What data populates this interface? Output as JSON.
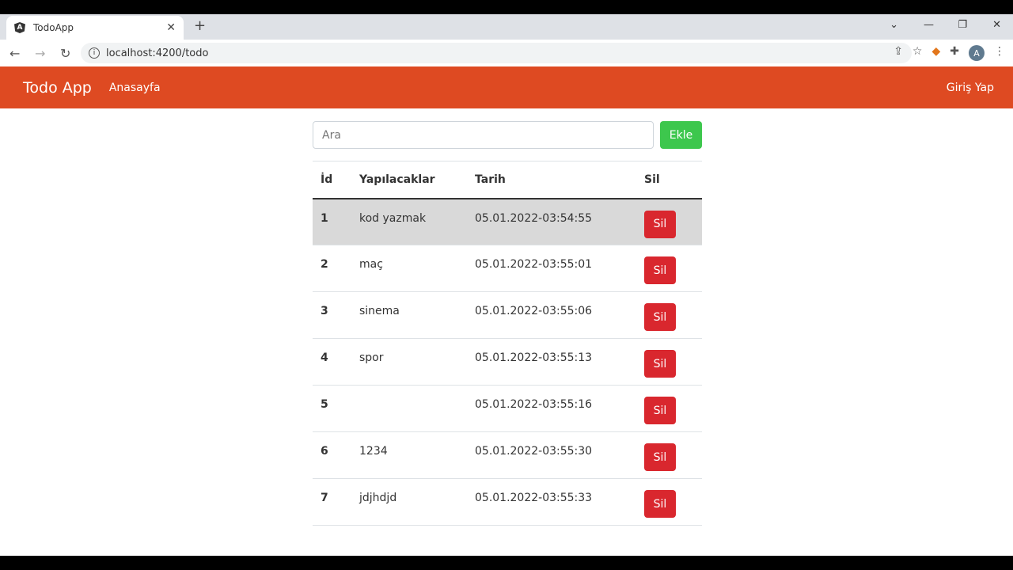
{
  "browser": {
    "tab_title": "TodoApp",
    "url": "localhost:4200/todo",
    "avatar_letter": "A"
  },
  "navbar": {
    "brand": "Todo App",
    "home": "Anasayfa",
    "login": "Giriş Yap"
  },
  "search": {
    "placeholder": "Ara",
    "add_label": "Ekle"
  },
  "table": {
    "headers": [
      "İd",
      "Yapılacaklar",
      "Tarih",
      "Sil"
    ],
    "delete_label": "Sil",
    "rows": [
      {
        "id": "1",
        "task": "kod yazmak",
        "date": "05.01.2022-03:54:55"
      },
      {
        "id": "2",
        "task": "maç",
        "date": "05.01.2022-03:55:01"
      },
      {
        "id": "3",
        "task": "sinema",
        "date": "05.01.2022-03:55:06"
      },
      {
        "id": "4",
        "task": "spor",
        "date": "05.01.2022-03:55:13"
      },
      {
        "id": "5",
        "task": "",
        "date": "05.01.2022-03:55:16"
      },
      {
        "id": "6",
        "task": "1234",
        "date": "05.01.2022-03:55:30"
      },
      {
        "id": "7",
        "task": "jdjhdjd",
        "date": "05.01.2022-03:55:33"
      }
    ]
  }
}
